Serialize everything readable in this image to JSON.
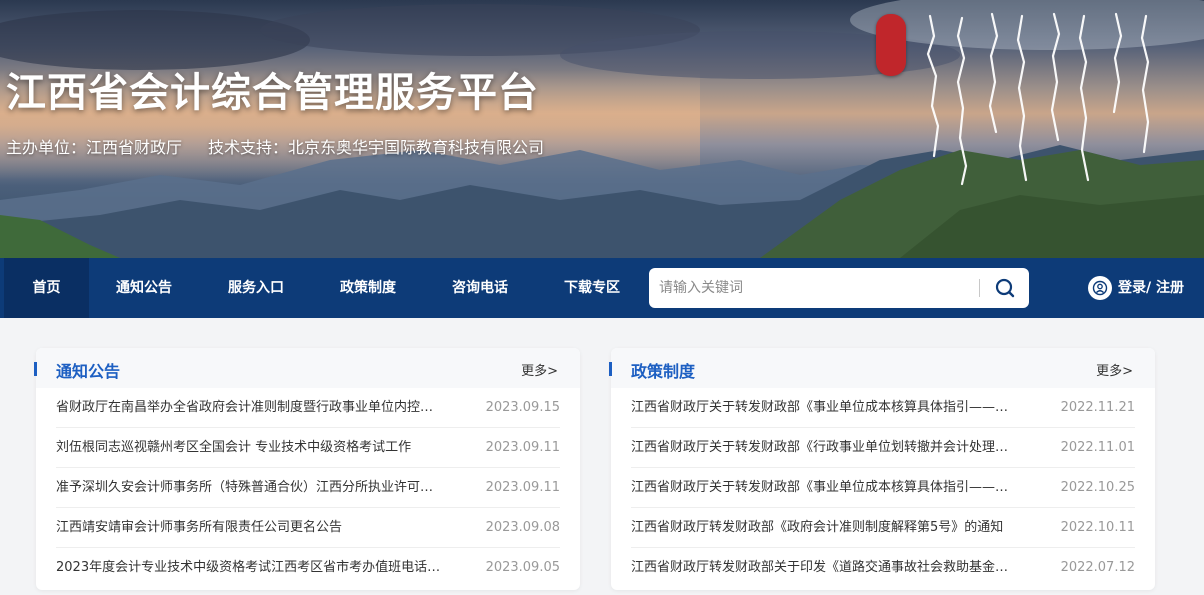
{
  "header": {
    "title": "江西省会计综合管理服务平台",
    "host_label": "主办单位：江西省财政厅",
    "tech_label": "技术支持：北京东奥华宇国际教育科技有限公司"
  },
  "nav": {
    "items": [
      {
        "label": "首页",
        "active": true
      },
      {
        "label": "通知公告",
        "active": false
      },
      {
        "label": "服务入口",
        "active": false
      },
      {
        "label": "政策制度",
        "active": false
      },
      {
        "label": "咨询电话",
        "active": false
      },
      {
        "label": "下载专区",
        "active": false
      }
    ],
    "search_placeholder": "请输入关键词",
    "search_icon": "search-icon",
    "login_label": "登录/ 注册",
    "login_icon": "user-icon"
  },
  "notices": {
    "title": "通知公告",
    "more": "更多>",
    "items": [
      {
        "title": "省财政厅在南昌举办全省政府会计准则制度暨行政事业单位内控…",
        "date": "2023.09.15"
      },
      {
        "title": "刘伍根同志巡视赣州考区全国会计 专业技术中级资格考试工作",
        "date": "2023.09.11"
      },
      {
        "title": "准予深圳久安会计师事务所（特殊普通合伙）江西分所执业许可…",
        "date": "2023.09.11"
      },
      {
        "title": "江西靖安靖审会计师事务所有限责任公司更名公告",
        "date": "2023.09.08"
      },
      {
        "title": "2023年度会计专业技术中级资格考试江西考区省市考办值班电话…",
        "date": "2023.09.05"
      }
    ]
  },
  "policies": {
    "title": "政策制度",
    "more": "更多>",
    "items": [
      {
        "title": "江西省财政厅关于转发财政部《事业单位成本核算具体指引——…",
        "date": "2022.11.21"
      },
      {
        "title": "江西省财政厅关于转发财政部《行政事业单位划转撤并会计处理…",
        "date": "2022.11.01"
      },
      {
        "title": "江西省财政厅关于转发财政部《事业单位成本核算具体指引——…",
        "date": "2022.10.25"
      },
      {
        "title": "江西省财政厅转发财政部《政府会计准则制度解释第5号》的通知",
        "date": "2022.10.11"
      },
      {
        "title": "江西省财政厅转发财政部关于印发《道路交通事故社会救助基金…",
        "date": "2022.07.12"
      }
    ]
  },
  "colors": {
    "nav_bg": "#0d3b78",
    "accent": "#1d5fc2",
    "seal": "#c0262b"
  }
}
